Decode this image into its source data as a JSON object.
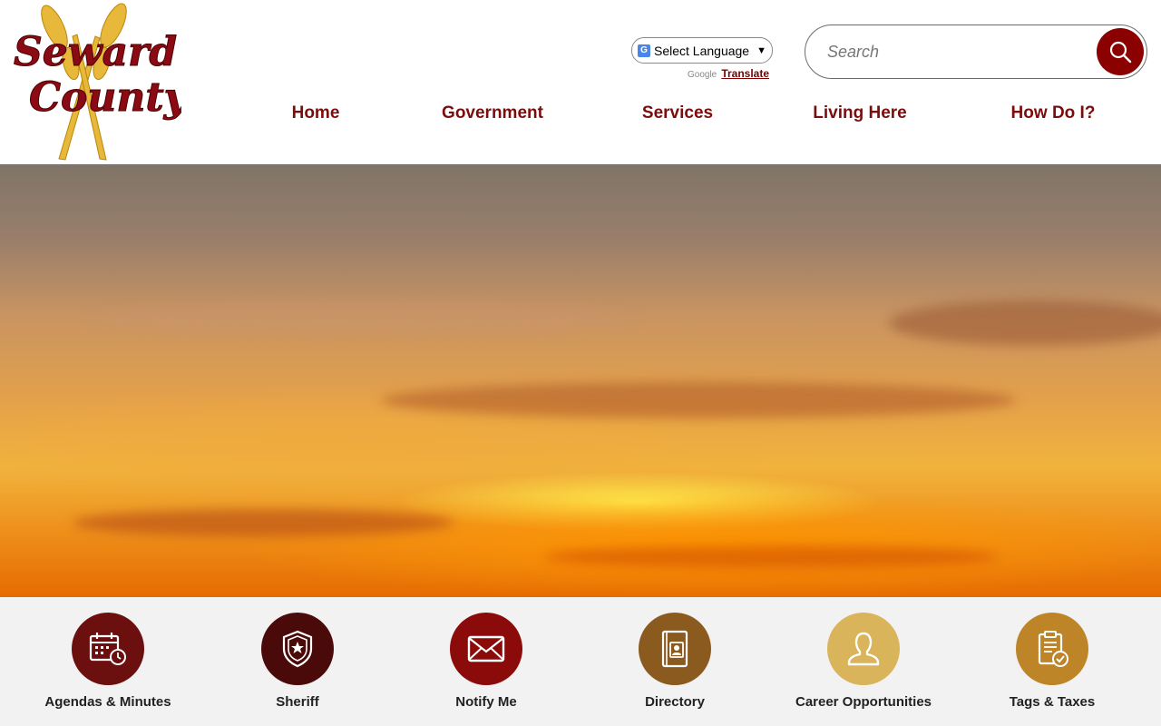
{
  "logo": {
    "line1": "Seward",
    "line2": "County"
  },
  "translate": {
    "select_label": "Select Language",
    "powered_by": "Google",
    "translate_link": "Translate"
  },
  "search": {
    "placeholder": "Search"
  },
  "nav": [
    {
      "label": "Home"
    },
    {
      "label": "Government"
    },
    {
      "label": "Services"
    },
    {
      "label": "Living Here"
    },
    {
      "label": "How Do I?"
    }
  ],
  "quicklinks": [
    {
      "label": "Agendas & Minutes",
      "icon": "calendar-clock-icon",
      "color": "#6b0f0f"
    },
    {
      "label": "Sheriff",
      "icon": "sheriff-badge-icon",
      "color": "#4a0a0a"
    },
    {
      "label": "Notify Me",
      "icon": "envelope-icon",
      "color": "#8b0a0a"
    },
    {
      "label": "Directory",
      "icon": "contact-book-icon",
      "color": "#8a5a1f"
    },
    {
      "label": "Career Opportunities",
      "icon": "person-icon",
      "color": "#d9b45a"
    },
    {
      "label": "Tags & Taxes",
      "icon": "clipboard-check-icon",
      "color": "#bd8428"
    }
  ],
  "colors": {
    "brand_red": "#8b0000",
    "nav_text": "#7a0d0d",
    "quicklinks_bg": "#f2f2f2"
  }
}
